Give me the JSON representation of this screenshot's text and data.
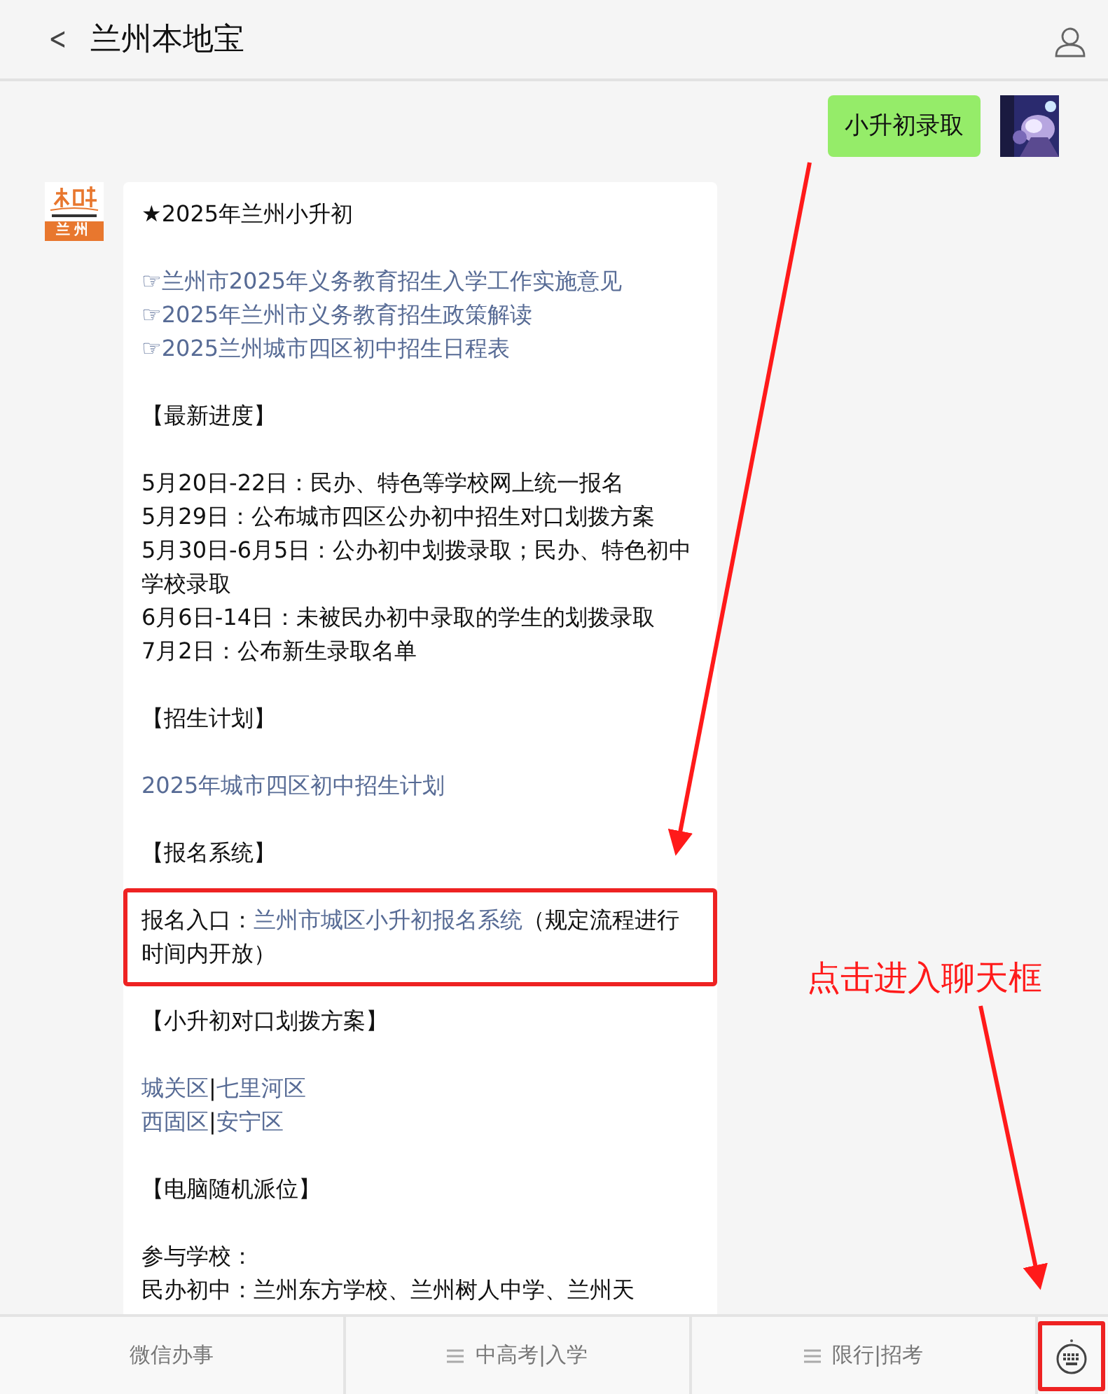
{
  "header": {
    "back": "<",
    "title": "兰州本地宝"
  },
  "messages": [
    {
      "kind": "sent_text",
      "text": "小升初录取"
    },
    {
      "kind": "received_article",
      "avatar_text": "兰州",
      "paragraphs": [
        {
          "highlighted": false,
          "lines": [
            [
              {
                "kind": "text",
                "text": "★2025年兰州小升初"
              }
            ]
          ]
        },
        {
          "highlighted": false,
          "lines": [
            [
              {
                "kind": "link",
                "text": "☞兰州市2025年义务教育招生入学工作实施意见"
              }
            ],
            [
              {
                "kind": "link",
                "text": "☞2025年兰州市义务教育招生政策解读"
              }
            ],
            [
              {
                "kind": "link",
                "text": "☞2025兰州城市四区初中招生日程表"
              }
            ]
          ]
        },
        {
          "highlighted": false,
          "lines": [
            [
              {
                "kind": "text",
                "text": "【最新进度】"
              }
            ]
          ]
        },
        {
          "highlighted": false,
          "lines": [
            [
              {
                "kind": "text",
                "text": "5月20日-22日：民办、特色等学校网上统一报名"
              }
            ],
            [
              {
                "kind": "text",
                "text": "5月29日：公布城市四区公办初中招生对口划拨方案"
              }
            ],
            [
              {
                "kind": "text",
                "text": "5月30日-6月5日：公办初中划拨录取；民办、特色初中学校录取"
              }
            ],
            [
              {
                "kind": "text",
                "text": "6月6日-14日：未被民办初中录取的学生的划拨录取"
              }
            ],
            [
              {
                "kind": "text",
                "text": "7月2日：公布新生录取名单"
              }
            ]
          ]
        },
        {
          "highlighted": false,
          "lines": [
            [
              {
                "kind": "text",
                "text": "【招生计划】"
              }
            ]
          ]
        },
        {
          "highlighted": false,
          "lines": [
            [
              {
                "kind": "link",
                "text": "2025年城市四区初中招生计划"
              }
            ]
          ]
        },
        {
          "highlighted": false,
          "lines": [
            [
              {
                "kind": "text",
                "text": "【报名系统】"
              }
            ]
          ]
        },
        {
          "highlighted": true,
          "lines": [
            [
              {
                "kind": "text",
                "text": "报名入口："
              },
              {
                "kind": "link",
                "text": "兰州市城区小升初报名系统"
              },
              {
                "kind": "text",
                "text": "（规定流程进行时间内开放）"
              }
            ]
          ]
        },
        {
          "highlighted": false,
          "lines": [
            [
              {
                "kind": "text",
                "text": "【小升初对口划拨方案】"
              }
            ]
          ]
        },
        {
          "highlighted": false,
          "lines": [
            [
              {
                "kind": "link",
                "text": "城关区"
              },
              {
                "kind": "text",
                "text": "|"
              },
              {
                "kind": "link",
                "text": "七里河区"
              }
            ],
            [
              {
                "kind": "link",
                "text": "西固区"
              },
              {
                "kind": "text",
                "text": "|"
              },
              {
                "kind": "link",
                "text": "安宁区"
              }
            ]
          ]
        },
        {
          "highlighted": false,
          "lines": [
            [
              {
                "kind": "text",
                "text": "【电脑随机派位】"
              }
            ]
          ]
        },
        {
          "highlighted": false,
          "lines": [
            [
              {
                "kind": "text",
                "text": "参与学校："
              }
            ],
            [
              {
                "kind": "text",
                "text": "民办初中：兰州东方学校、兰州树人中学、兰州天"
              }
            ]
          ]
        }
      ]
    }
  ],
  "menu": [
    {
      "label": "微信办事",
      "has_submenu": false
    },
    {
      "label": "中高考|入学",
      "has_submenu": true
    },
    {
      "label": "限行|招考",
      "has_submenu": true
    }
  ],
  "keyboard_button": {
    "highlighted": true
  },
  "annotation": {
    "text": "点击进入聊天框"
  }
}
